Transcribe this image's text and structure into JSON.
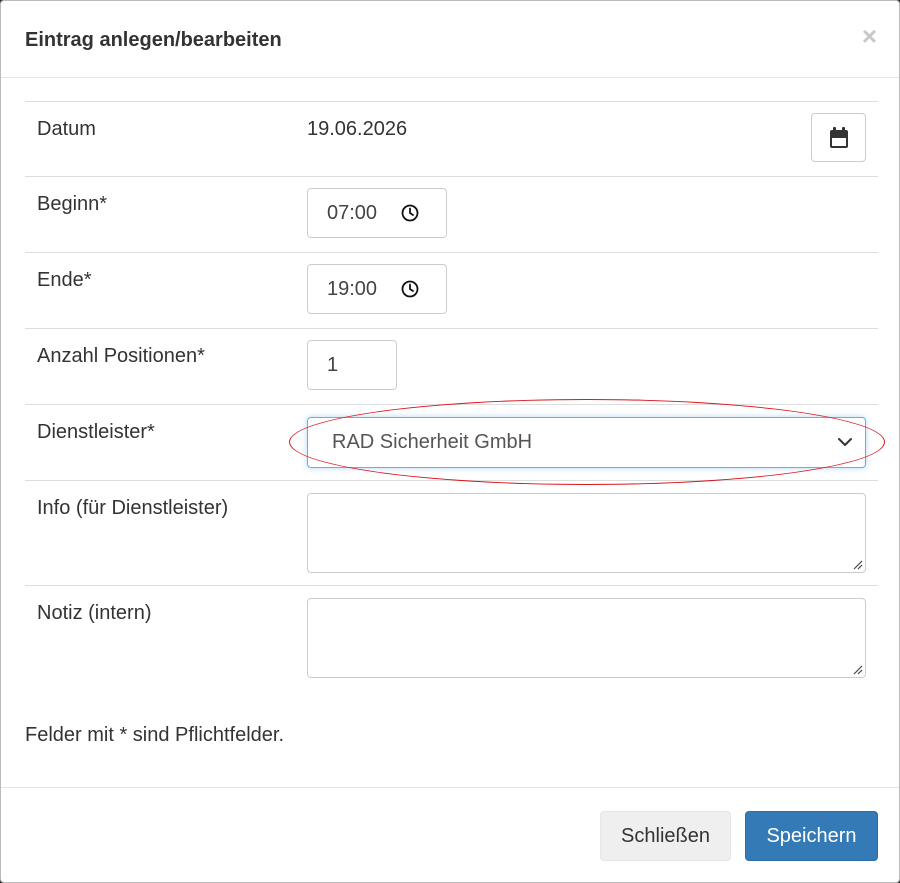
{
  "dialog": {
    "title": "Eintrag anlegen/bearbeiten",
    "close_symbol": "×"
  },
  "form": {
    "datum": {
      "label": "Datum",
      "value": "19.06.2026",
      "button_icon": "calendar-icon"
    },
    "beginn": {
      "label": "Beginn*",
      "value": "07:00",
      "icon": "clock-icon"
    },
    "ende": {
      "label": "Ende*",
      "value": "19:00",
      "icon": "clock-icon"
    },
    "positionen": {
      "label": "Anzahl Positionen*",
      "value": "1"
    },
    "dienstleister": {
      "label": "Dienstleister*",
      "selected": "RAD Sicherheit GmbH",
      "icon": "chevron-down-icon"
    },
    "info": {
      "label": "Info (für Dienstleister)",
      "value": ""
    },
    "notiz": {
      "label": "Notiz (intern)",
      "value": ""
    }
  },
  "required_note": "Felder mit * sind Pflichtfelder.",
  "footer": {
    "close_label": "Schließen",
    "save_label": "Speichern"
  },
  "colors": {
    "primary": "#337ab7",
    "annotation": "#d9141b",
    "focus": "#66afe9"
  }
}
